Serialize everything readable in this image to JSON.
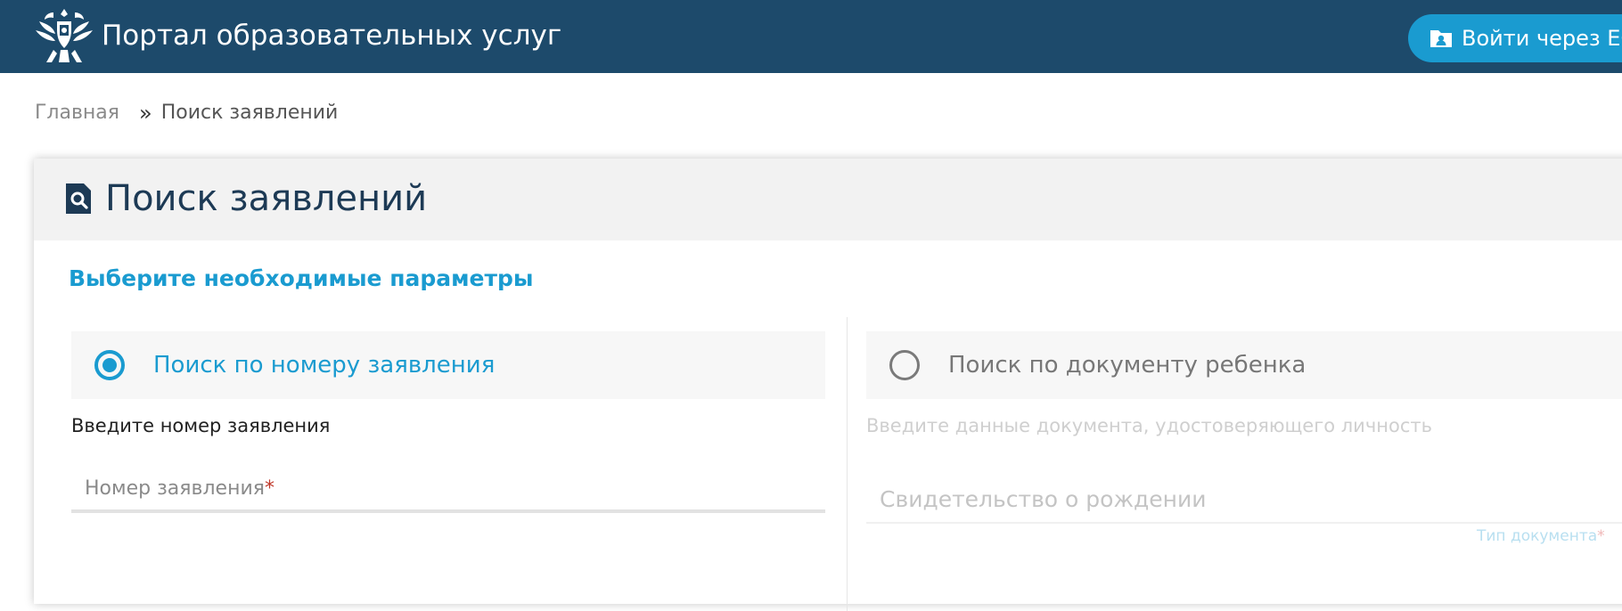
{
  "header": {
    "title": "Портал образовательных услуг",
    "login_label": "Войти через ЕСИ",
    "emblem_icon": "coat-of-arms-icon",
    "login_icon": "user-folder-icon",
    "background": "#1d4a6b",
    "button_color": "#1a9bd0"
  },
  "breadcrumb": {
    "home": "Главная",
    "separator": "»",
    "current": "Поиск заявлений"
  },
  "card": {
    "title": "Поиск заявлений",
    "title_icon": "search-document-icon",
    "section_title": "Выберите необходимые параметры",
    "options": [
      {
        "label": "Поиск по номеру заявления",
        "selected": true
      },
      {
        "label": "Поиск по документу ребенка",
        "selected": false
      }
    ],
    "left": {
      "hint": "Введите номер заявления",
      "placeholder": "Номер заявления",
      "required_mark": "*"
    },
    "right": {
      "hint": "Введите данные документа, удостоверяющего личность",
      "select_value": "Свидетельство о рождении",
      "select_label": "Тип документа",
      "required_mark": "*"
    }
  },
  "colors": {
    "accent": "#1a9bd0",
    "required": "#c0392b"
  }
}
